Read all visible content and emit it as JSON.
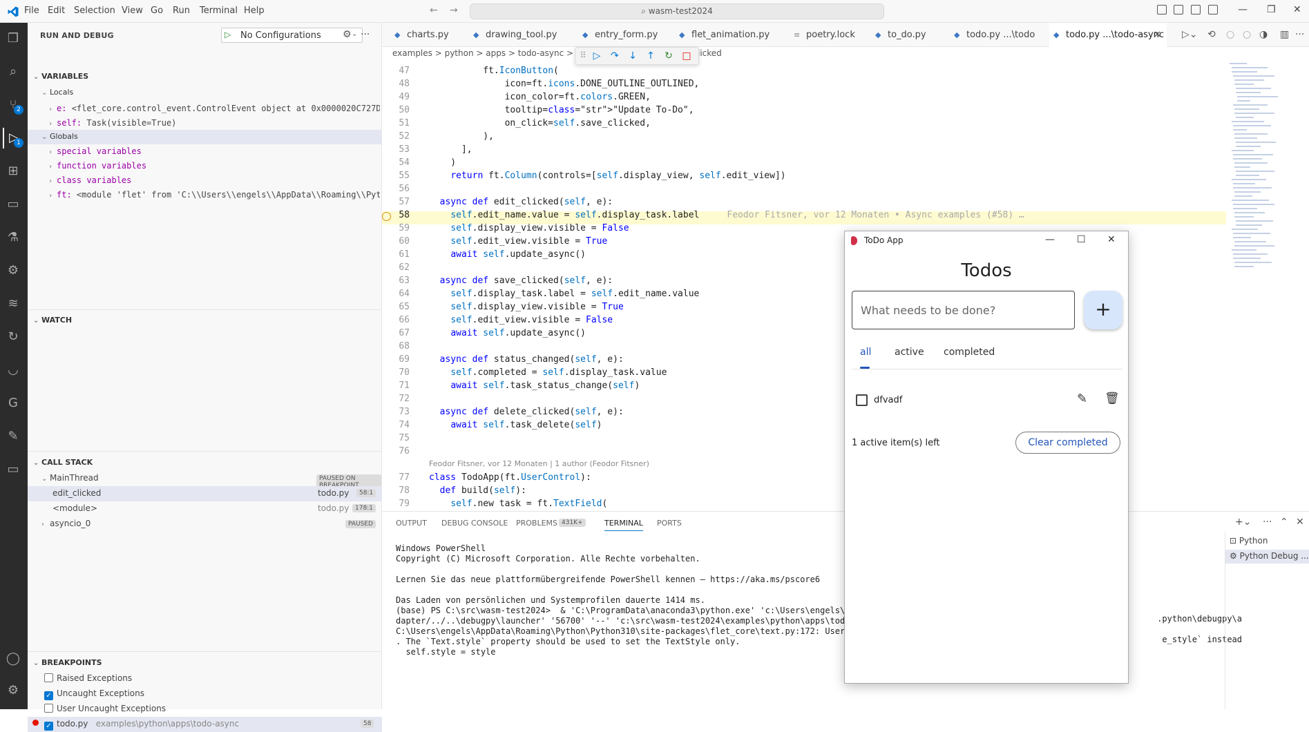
{
  "titlebar": {
    "menu": [
      "File",
      "Edit",
      "Selection",
      "View",
      "Go",
      "Run",
      "Terminal",
      "Help"
    ],
    "search": "wasm-test2024"
  },
  "sidebar": {
    "header": "RUN AND DEBUG",
    "config": "No Configurations",
    "variables_title": "VARIABLES",
    "locals_title": "Locals",
    "locals": [
      {
        "name": "e:",
        "value": "<flet_core.control_event.ControlEvent object at 0x0000020C727D…"
      },
      {
        "name": "self:",
        "value": "Task(visible=True)"
      }
    ],
    "globals_title": "Globals",
    "globals": [
      "special variables",
      "function variables",
      "class variables"
    ],
    "globals_ft": {
      "name": "ft:",
      "value": "<module 'flet' from 'C:\\\\Users\\\\engels\\\\AppData\\\\Roaming\\\\Pyt…"
    },
    "watch_title": "WATCH",
    "callstack_title": "CALL STACK",
    "thread": "MainThread",
    "thread_state": "PAUSED ON BREAKPOINT",
    "frames": [
      {
        "name": "edit_clicked",
        "file": "todo.py",
        "pos": "58:1"
      },
      {
        "name": "<module>",
        "file": "todo.py",
        "pos": "178:1"
      }
    ],
    "thread2": "asyncio_0",
    "thread2_state": "PAUSED",
    "breakpoints_title": "BREAKPOINTS",
    "breakpoints": [
      {
        "label": "Raised Exceptions",
        "checked": false
      },
      {
        "label": "Uncaught Exceptions",
        "checked": true
      },
      {
        "label": "User Uncaught Exceptions",
        "checked": false
      }
    ],
    "bp_file": {
      "name": "todo.py",
      "path": "examples\\python\\apps\\todo-async",
      "line": "58"
    }
  },
  "tabs": [
    "charts.py",
    "drawing_tool.py",
    "entry_form.py",
    "flet_animation.py",
    "poetry.lock",
    "to_do.py",
    "todo.py ...\\todo",
    "todo.py ...\\todo-async"
  ],
  "breadcrumb": {
    "path": "examples  >  python  >  apps  >  todo-async  >",
    "tail": "licked"
  },
  "editor": {
    "blame_inline": "Feodor Fitsner, vor 12 Monaten • Async examples (#58) …",
    "blame_class": "Feodor Fitsner, vor 12 Monaten | 1 author (Feodor Fitsner)",
    "lines": [
      {
        "n": "47",
        "html": "          ft.IconButton("
      },
      {
        "n": "48",
        "html": "              icon=ft.icons.DONE_OUTLINE_OUTLINED,"
      },
      {
        "n": "49",
        "html": "              icon_color=ft.colors.GREEN,"
      },
      {
        "n": "50",
        "html": "              tooltip=\"Update To-Do\","
      },
      {
        "n": "51",
        "html": "              on_click=self.save_clicked,"
      },
      {
        "n": "52",
        "html": "          ),"
      },
      {
        "n": "53",
        "html": "      ],"
      },
      {
        "n": "54",
        "html": "    )"
      },
      {
        "n": "55",
        "html": "    return ft.Column(controls=[self.display_view, self.edit_view])"
      },
      {
        "n": "56",
        "html": ""
      },
      {
        "n": "57",
        "html": "  async def edit_clicked(self, e):"
      },
      {
        "n": "58",
        "html": "    self.edit_name.value = self.display_task.label"
      },
      {
        "n": "59",
        "html": "    self.display_view.visible = False"
      },
      {
        "n": "60",
        "html": "    self.edit_view.visible = True"
      },
      {
        "n": "61",
        "html": "    await self.update_async()"
      },
      {
        "n": "62",
        "html": ""
      },
      {
        "n": "63",
        "html": "  async def save_clicked(self, e):"
      },
      {
        "n": "64",
        "html": "    self.display_task.label = self.edit_name.value"
      },
      {
        "n": "65",
        "html": "    self.display_view.visible = True"
      },
      {
        "n": "66",
        "html": "    self.edit_view.visible = False"
      },
      {
        "n": "67",
        "html": "    await self.update_async()"
      },
      {
        "n": "68",
        "html": ""
      },
      {
        "n": "69",
        "html": "  async def status_changed(self, e):"
      },
      {
        "n": "70",
        "html": "    self.completed = self.display_task.value"
      },
      {
        "n": "71",
        "html": "    await self.task_status_change(self)"
      },
      {
        "n": "72",
        "html": ""
      },
      {
        "n": "73",
        "html": "  async def delete_clicked(self, e):"
      },
      {
        "n": "74",
        "html": "    await self.task_delete(self)"
      },
      {
        "n": "75",
        "html": ""
      },
      {
        "n": "76",
        "html": ""
      },
      {
        "n": "77",
        "html": "class TodoApp(ft.UserControl):"
      },
      {
        "n": "78",
        "html": "  def build(self):"
      },
      {
        "n": "79",
        "html": "    self.new_task = ft.TextField("
      }
    ]
  },
  "panel": {
    "tabs": [
      "OUTPUT",
      "DEBUG CONSOLE",
      "PROBLEMS",
      "TERMINAL",
      "PORTS"
    ],
    "problems_count": "431K+",
    "terminal": [
      "Windows PowerShell",
      "Copyright (C) Microsoft Corporation. Alle Rechte vorbehalten.",
      "",
      "Lernen Sie das neue plattformübergreifende PowerShell kennen – https://aka.ms/pscore6",
      "",
      "Das Laden von persönlichen und Systemprofilen dauerte 1414 ms.",
      "(base) PS C:\\src\\wasm-test2024>  & 'C:\\ProgramData\\anaconda3\\python.exe' 'c:\\Users\\engels\\.vs",
      "dapter/../..\\debugpy\\launcher' '56700' '--' 'c:\\src\\wasm-test2024\\examples\\python\\apps\\todo-a",
      "C:\\Users\\engels\\AppData\\Roaming\\Python\\Python310\\site-packages\\flet_core\\text.py:172: UserWar",
      ". The `Text.style` property should be used to set the TextStyle only.",
      "  self.style = style"
    ],
    "terminal_right": [
      ".python\\debugpy\\a",
      "",
      "e_style` instead"
    ],
    "term_list": [
      "Python",
      "Python Debug ..."
    ]
  },
  "app": {
    "title": "ToDo App",
    "heading": "Todos",
    "placeholder": "What needs to be done?",
    "add": "+",
    "filters": [
      "all",
      "active",
      "completed"
    ],
    "task": "dfvadf",
    "items_left": "1 active item(s) left",
    "clear": "Clear completed"
  }
}
